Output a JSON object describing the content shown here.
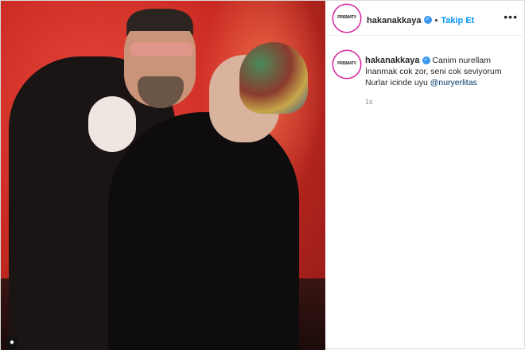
{
  "post": {
    "author": {
      "username": "hakanakkaya",
      "avatar_text": "PRISMATV",
      "verified": true
    },
    "follow_label": "Takip Et",
    "separator": "•",
    "more_label": "•••",
    "caption": {
      "username": "hakanakkaya",
      "line1": "Canim nurellam",
      "line2": "İnanmak cok zor, seni cok seviyorum",
      "line3_prefix": "Nurlar icinde uyu ",
      "mention": "@nuryerlitas"
    },
    "timestamp": "1s",
    "photo_badge_icon": "user-tag-icon"
  },
  "colors": {
    "accent": "#0095f6",
    "verified_badge": "#3897f0",
    "mention": "#00376b"
  }
}
